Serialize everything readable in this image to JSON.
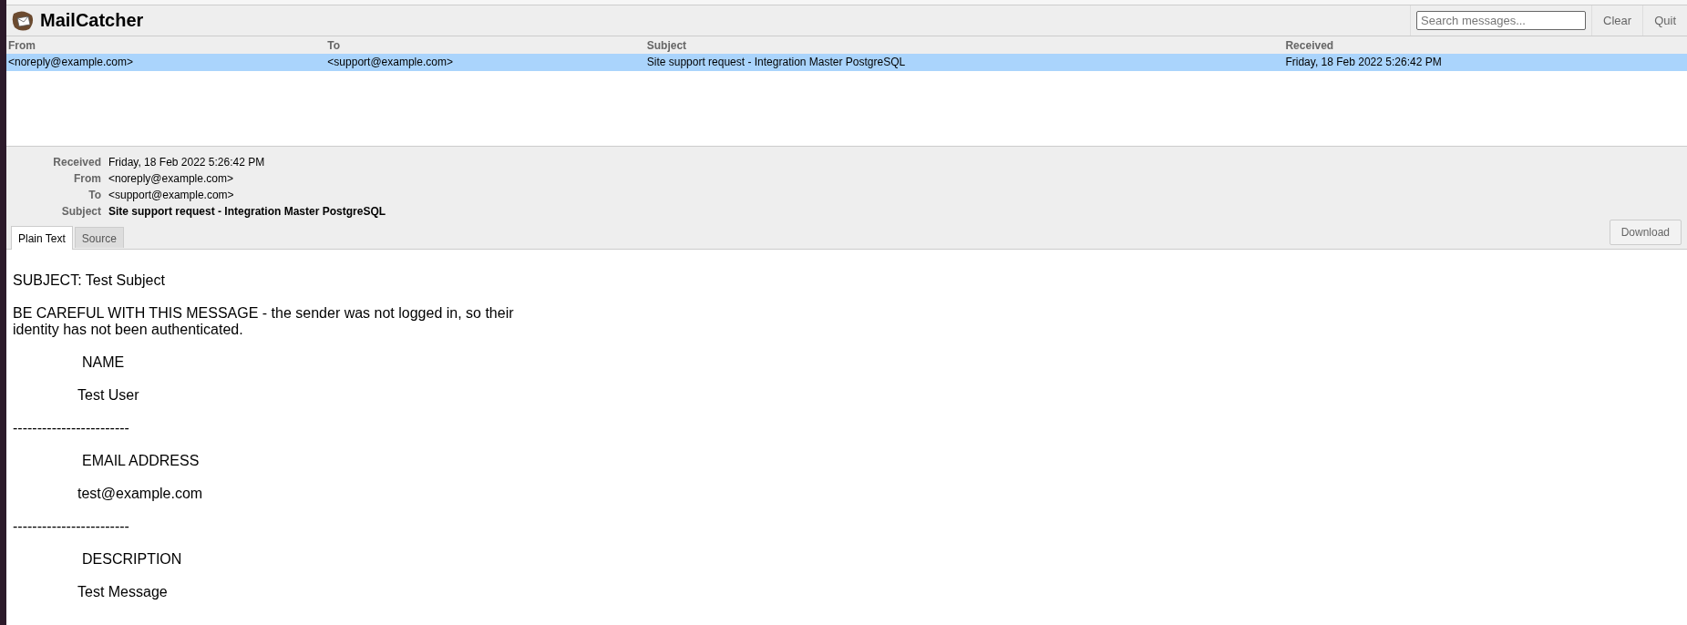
{
  "app": {
    "title": "MailCatcher"
  },
  "search": {
    "placeholder": "Search messages..."
  },
  "header_buttons": [
    "Clear",
    "Quit"
  ],
  "table": {
    "columns": [
      "From",
      "To",
      "Subject",
      "Received"
    ],
    "rows": [
      {
        "selected": true,
        "cells": [
          "<noreply@example.com>",
          "<support@example.com>",
          "Site support request - Integration Master PostgreSQL",
          "Friday, 18 Feb 2022 5:26:42 PM"
        ]
      }
    ]
  },
  "metadata": [
    {
      "label": "Received",
      "value": "Friday, 18 Feb 2022 5:26:42 PM",
      "bold": false
    },
    {
      "label": "From",
      "value": "<noreply@example.com>",
      "bold": false
    },
    {
      "label": "To",
      "value": "<support@example.com>",
      "bold": false
    },
    {
      "label": "Subject",
      "value": "Site support request - Integration Master PostgreSQL",
      "bold": true
    }
  ],
  "tabs": [
    {
      "label": "Plain Text",
      "selected": true
    },
    {
      "label": "Source",
      "selected": false
    }
  ],
  "download": "Download",
  "body": [
    {
      "kind": "text",
      "text": "SUBJECT: Test Subject"
    },
    {
      "kind": "text",
      "text": "BE CAREFUL WITH THIS MESSAGE - the sender was not logged in, so their identity has not been authenticated."
    },
    {
      "kind": "label",
      "text": "NAME"
    },
    {
      "kind": "value",
      "text": "Test User"
    },
    {
      "kind": "text",
      "text": "------------------------"
    },
    {
      "kind": "label",
      "text": "EMAIL ADDRESS"
    },
    {
      "kind": "value",
      "text": "test@example.com"
    },
    {
      "kind": "text",
      "text": "------------------------"
    },
    {
      "kind": "label",
      "text": "DESCRIPTION"
    },
    {
      "kind": "value",
      "text": "Test Message"
    }
  ]
}
